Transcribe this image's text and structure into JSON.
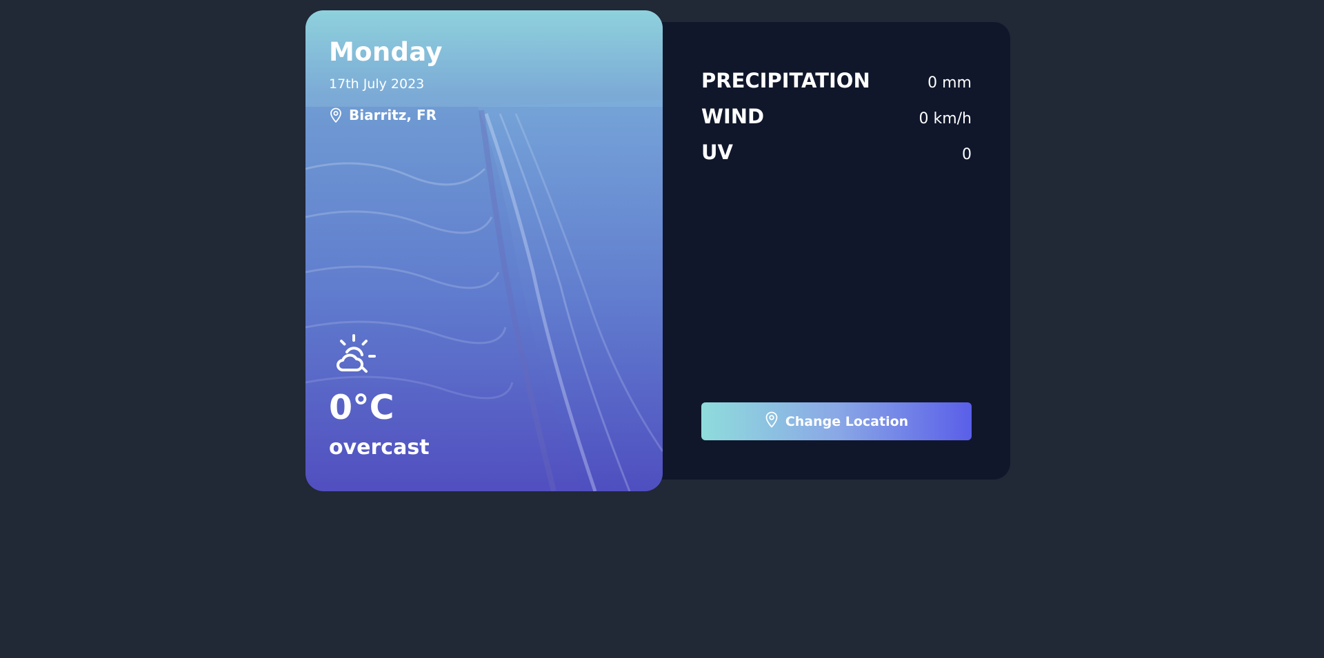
{
  "weather_card": {
    "day": "Monday",
    "date": "17th July 2023",
    "location": "Biarritz, FR",
    "location_icon": "map-pin-icon",
    "condition_icon": "sun-behind-cloud-icon",
    "temperature": "0°C",
    "condition": "overcast"
  },
  "details": {
    "precipitation": {
      "label": "PRECIPITATION",
      "value": "0 mm"
    },
    "wind": {
      "label": "WIND",
      "value": "0 km/h"
    },
    "uv": {
      "label": "UV",
      "value": "0"
    }
  },
  "actions": {
    "change_location_label": "Change Location",
    "change_location_icon": "map-pin-icon"
  },
  "colors": {
    "page_background": "#212836",
    "panel_background": "#10172b",
    "accent_start": "#8fdcdc",
    "accent_end": "#5a5fe8",
    "text": "#ffffff"
  }
}
